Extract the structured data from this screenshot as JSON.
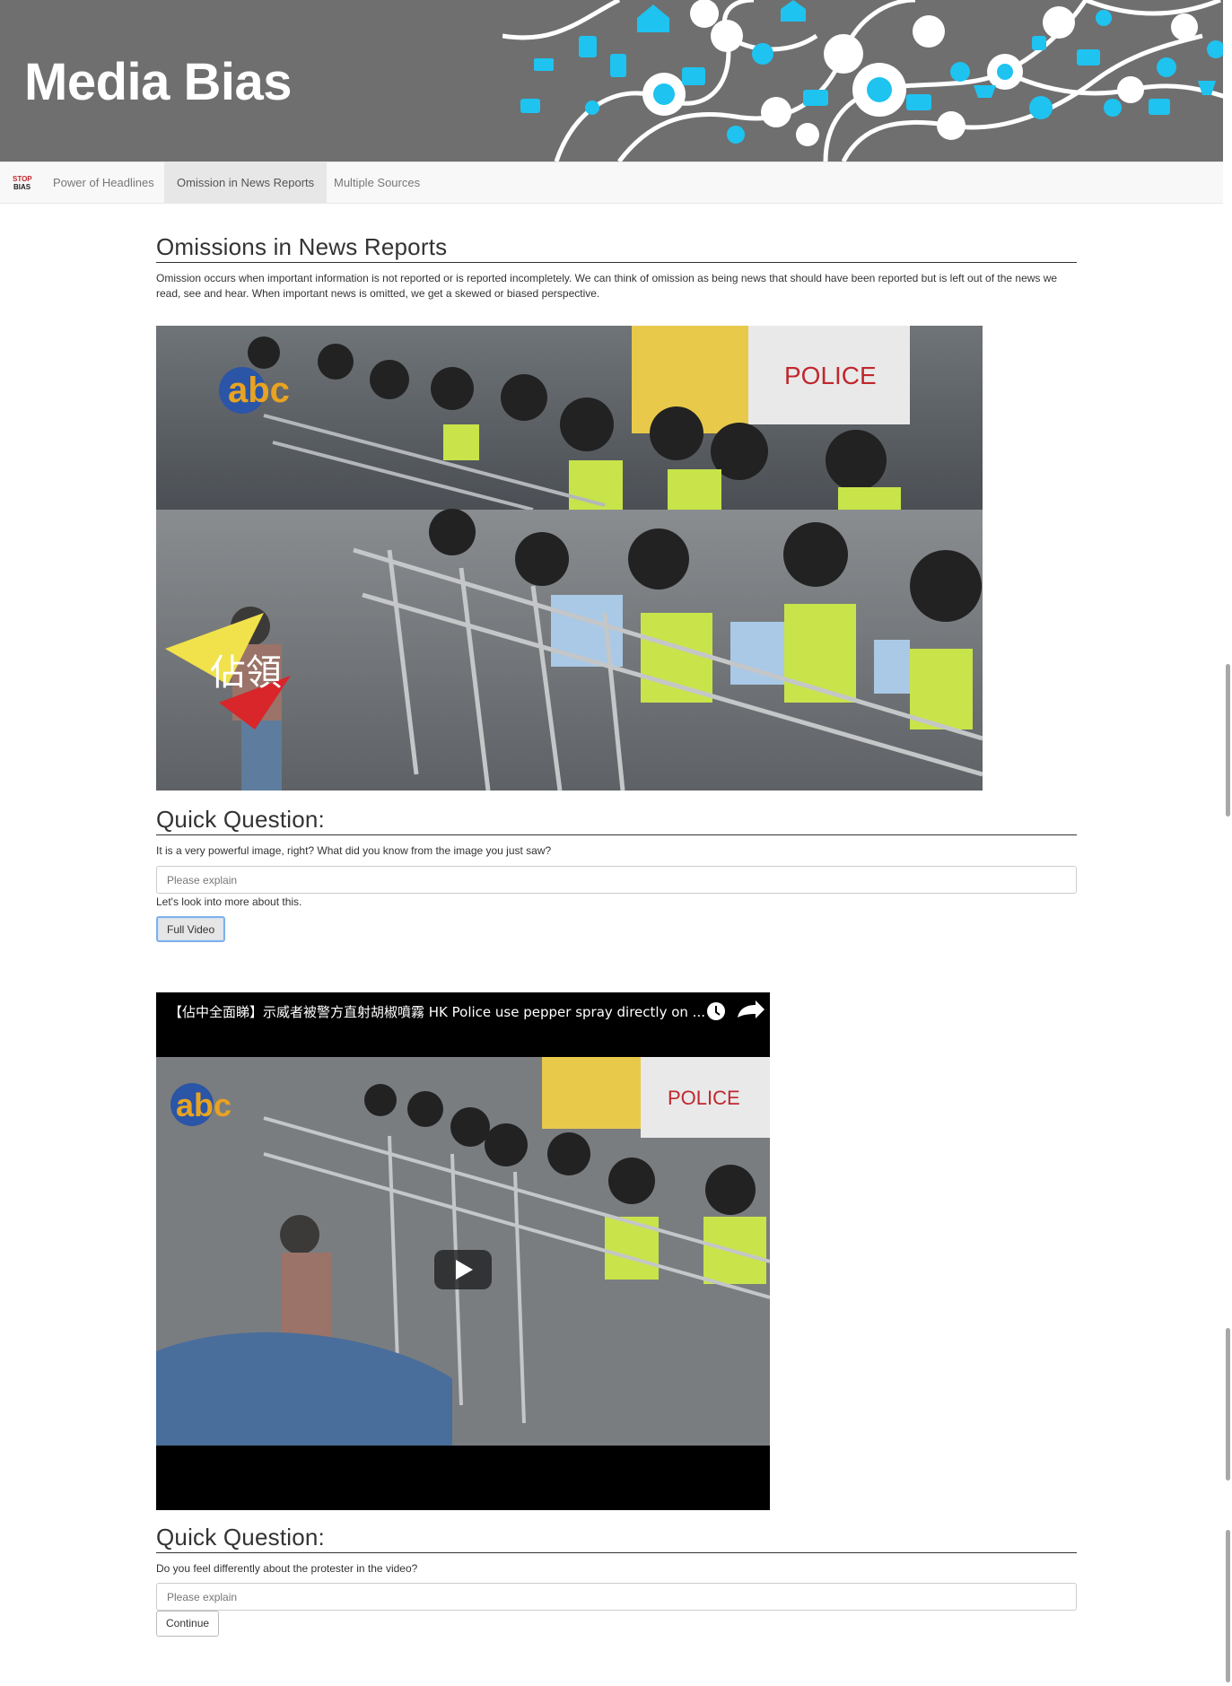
{
  "header": {
    "title": "Media Bias",
    "banner_accent": "#1ec3f0",
    "banner_bg": "#6f6f6f"
  },
  "nav": {
    "brand_icon": "stop-bias-logo-icon",
    "items": [
      {
        "label": "Power of Headlines",
        "active": false
      },
      {
        "label": "Omission in News Reports",
        "active": true
      },
      {
        "label": "Multiple Sources",
        "active": false
      }
    ]
  },
  "section": {
    "heading": "Omissions in News Reports",
    "intro": "Omission occurs when important information is not reported or is reported incompletely. We can think of omission as being news that should have been reported but is left out of the news we read, see and hear. When important news is omitted, we get a skewed or biased perspective.",
    "photo_caption_glyphs": "佔領",
    "photo_logo": "abc"
  },
  "question1": {
    "heading": "Quick Question:",
    "prompt": "It is a very powerful image, right? What did you know from the image you just saw?",
    "placeholder": "Please explain",
    "followup": "Let's look into more about this.",
    "button": "Full Video"
  },
  "video": {
    "title": "【佔中全面睇】示威者被警方直射胡椒噴霧 HK Police use pepper spray directly on ...",
    "clock_icon": "watch-later-icon",
    "share_icon": "share-icon",
    "play_icon": "play-icon",
    "logo": "abc"
  },
  "question2": {
    "heading": "Quick Question:",
    "prompt": "Do you feel differently about the protester in the video?",
    "placeholder": "Please explain",
    "button": "Continue"
  }
}
